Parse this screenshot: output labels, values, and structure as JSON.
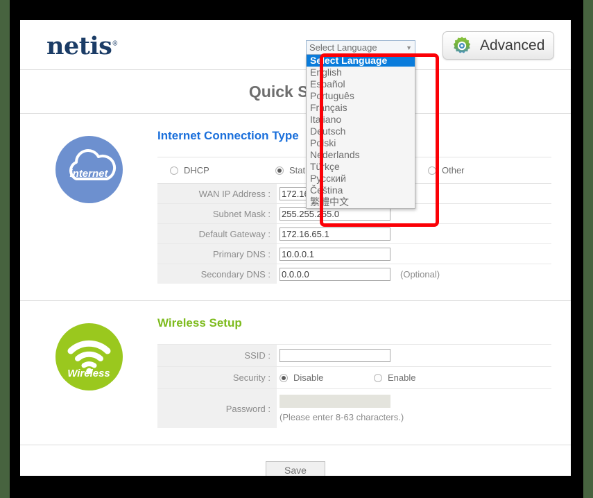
{
  "brand": {
    "logo_text": "netis",
    "registered_mark": "®"
  },
  "header": {
    "advanced_button": "Advanced",
    "gear_icon": "gear-icon"
  },
  "language_select": {
    "current_value": "Select Language",
    "dropdown_arrow": "▼",
    "expanded": true,
    "options": [
      "Select Language",
      "English",
      "Español",
      "Português",
      "Français",
      "Italiano",
      "Deutsch",
      "Polski",
      "Nederlands",
      "Türkçe",
      "Русский",
      "Čeština",
      "繁體中文"
    ],
    "highlighted_option": "Select Language",
    "highlight_color": "#0a7cdb"
  },
  "annotation": {
    "shape": "rectangle",
    "color": "#fb0006"
  },
  "page": {
    "title": "Quick Setup",
    "title_visible_text": "Quick S"
  },
  "internet_section": {
    "icon_label": "internet",
    "icon_color": "#6d90cf",
    "heading": "Internet Connection Type",
    "heading_color": "#1a6fdb",
    "connection_types": [
      {
        "label": "DHCP",
        "selected": false
      },
      {
        "label": "Static IP",
        "selected": true
      },
      {
        "label": "Other",
        "selected": false
      }
    ],
    "fields": [
      {
        "label": "WAN IP Address :",
        "value": "172.16.65.2",
        "note": "",
        "disabled": false
      },
      {
        "label": "Subnet Mask :",
        "value": "255.255.255.0",
        "note": "",
        "disabled": false
      },
      {
        "label": "Default Gateway :",
        "value": "172.16.65.1",
        "note": "",
        "disabled": false
      },
      {
        "label": "Primary DNS :",
        "value": "10.0.0.1",
        "note": "",
        "disabled": false
      },
      {
        "label": "Secondary DNS :",
        "value": "0.0.0.0",
        "note": "(Optional)",
        "disabled": false
      }
    ]
  },
  "wireless_section": {
    "icon_label": "Wireless",
    "icon_color": "#9ac81e",
    "heading": "Wireless Setup",
    "heading_color": "#7dbb1d",
    "ssid_label": "SSID :",
    "ssid_value": "",
    "security_label": "Security :",
    "security_options": [
      {
        "label": "Disable",
        "selected": true
      },
      {
        "label": "Enable",
        "selected": false
      }
    ],
    "password_label": "Password :",
    "password_value": "",
    "password_hint": "(Please enter 8-63 characters.)"
  },
  "footer": {
    "save_label": "Save"
  }
}
